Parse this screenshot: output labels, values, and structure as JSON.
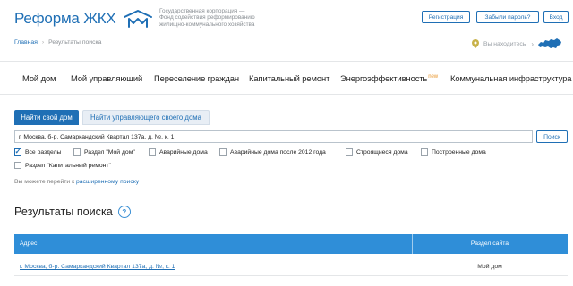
{
  "header": {
    "logo_text": "Реформа ЖКХ",
    "corp_line1": "Государственная корпорация —",
    "corp_line2": "Фонд содействия реформированию",
    "corp_line3": "жилищно-коммунального хозяйства",
    "register_label": "Регистрация",
    "forgot_label": "Забыли пароль?",
    "login_label": "Вход",
    "location_label": "Вы находитесь"
  },
  "breadcrumb": {
    "home": "Главная",
    "current": "Результаты поиска"
  },
  "nav": {
    "items": [
      "Мой дом",
      "Мой управляющий",
      "Переселение граждан",
      "Капитальный ремонт",
      "Энергоэффективность",
      "Коммунальная инфраструктура"
    ],
    "new_badge": "new"
  },
  "search": {
    "tab_active": "Найти свой дом",
    "tab_inactive": "Найти управляющего своего дома",
    "query": "г. Москва, б-р. Самаркандский Квартал 137а, д. №, к. 1",
    "button_label": "Поиск"
  },
  "filters": [
    {
      "label": "Все разделы",
      "checked": true
    },
    {
      "label": "Раздел \"Мой дом\"",
      "checked": false
    },
    {
      "label": "Аварийные дома",
      "checked": false
    },
    {
      "label": "Аварийные дома после 2012 года",
      "checked": false
    },
    {
      "label": "Строящиеся дома",
      "checked": false
    },
    {
      "label": "Построенные дома",
      "checked": false
    },
    {
      "label": "Раздел \"Капитальный ремонт\"",
      "checked": false
    }
  ],
  "hint": {
    "text": "Вы можете перейти к",
    "link": "расширенному поиску"
  },
  "results": {
    "title": "Результаты поиска",
    "help_symbol": "?",
    "columns": [
      "Адрес",
      "Раздел сайта"
    ],
    "rows": [
      {
        "address": "г. Москва, б-р. Самаркандский Квартал 137а, д. №, к. 1",
        "section": "Мой дом"
      }
    ]
  },
  "colors": {
    "brand": "#1f6fb5",
    "table_header": "#2f8ed8",
    "badge_new": "#e8952b"
  }
}
